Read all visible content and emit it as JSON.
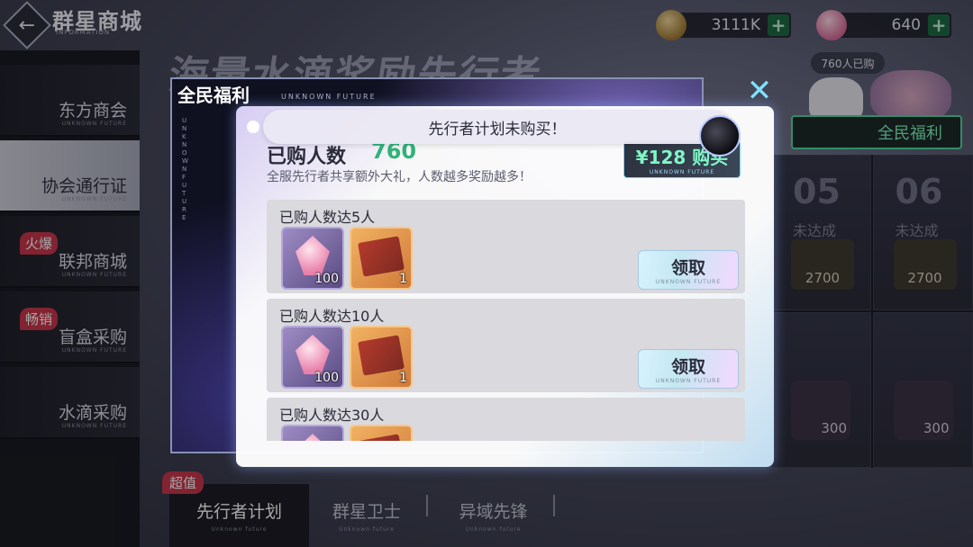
{
  "header": {
    "store_title": "群星商城",
    "store_sub": "INFORMATION",
    "back_icon": "arrow-left-icon"
  },
  "currencies": [
    {
      "name": "coin",
      "value": "3111K",
      "icon": "coin-icon",
      "color": "#c59a4a"
    },
    {
      "name": "gem",
      "value": "640",
      "icon": "pink-gem-icon",
      "color": "#e58ab0"
    }
  ],
  "background": {
    "title": "海量水滴奖励先行者",
    "cells": [
      {
        "num": "05",
        "status": "未达成",
        "price": "2700"
      },
      {
        "num": "06",
        "status": "未达成",
        "price": "2700"
      },
      {
        "num": "",
        "status": "",
        "price": "300"
      },
      {
        "num": "",
        "status": "",
        "price": "300"
      }
    ]
  },
  "sidebar": {
    "items": [
      {
        "label": "东方商会",
        "sub": "UNKNOWN FUTURE",
        "badge": ""
      },
      {
        "label": "协会通行证",
        "sub": "UNKNOWN FUTURE",
        "badge": ""
      },
      {
        "label": "联邦商城",
        "sub": "UNKNOWN FUTURE",
        "badge": "火爆"
      },
      {
        "label": "盲盒采购",
        "sub": "UNKNOWN FUTURE",
        "badge": "畅销"
      },
      {
        "label": "水滴采购",
        "sub": "UNKNOWN FUTURE",
        "badge": ""
      }
    ]
  },
  "bottom_tabs": {
    "badge": "超值",
    "tabs": [
      {
        "label": "先行者计划",
        "sub": "Unknown future"
      },
      {
        "label": "群星卫士",
        "sub": "Unknown future"
      },
      {
        "label": "异域先锋",
        "sub": "Unknown future"
      }
    ]
  },
  "welfare_banner": {
    "bubble": "760人已购",
    "button": "全民福利"
  },
  "modal": {
    "outer_title": "全民福利",
    "outer_sub": "UNKNOWN FUTURE",
    "vertical_text": "UNKNOWN FUTURE",
    "toast": "先行者计划未购买！",
    "count_label": "已购人数",
    "count_value": "760",
    "description": "全服先行者共享额外大礼，人数越多奖励越多！",
    "buy_button": {
      "label": "¥128 购买",
      "sub": "UNKNOWN FUTURE"
    },
    "rows": [
      {
        "label": "已购人数达5人",
        "gem_qty": "100",
        "book_qty": "1",
        "claim": "领取",
        "claim_sub": "UNKNOWN FUTURE"
      },
      {
        "label": "已购人数达10人",
        "gem_qty": "100",
        "book_qty": "1",
        "claim": "领取",
        "claim_sub": "UNKNOWN FUTURE"
      },
      {
        "label": "已购人数达30人",
        "gem_qty": "",
        "book_qty": "",
        "claim": "",
        "claim_sub": ""
      }
    ]
  },
  "colors": {
    "accent_green": "#2fb37a",
    "close_cyan": "#7fe3ff",
    "badge_red": "#c8364c"
  }
}
